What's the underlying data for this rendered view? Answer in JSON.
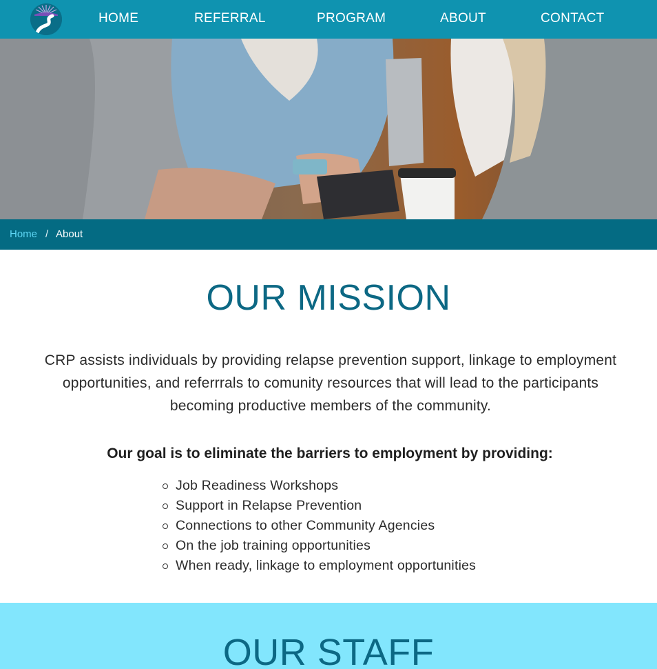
{
  "nav": {
    "items": [
      "HOME",
      "REFERRAL",
      "PROGRAM",
      "ABOUT",
      "CONTACT"
    ]
  },
  "breadcrumb": {
    "home": "Home",
    "separator": "/",
    "current": "About"
  },
  "mission": {
    "title": "OUR MISSION",
    "text": "CRP assists individuals by providing relapse prevention support, linkage to employment opportunities, and referrrals to comunity resources that will lead to the participants becoming productive members of the community.",
    "goal": "Our goal is to eliminate the barriers to employment by providing:",
    "list": [
      "Job Readiness Workshops",
      "Support in Relapse Prevention",
      "Connections to other Community Agencies",
      "On the job training opportunities",
      "When ready, linkage to employment opportunities"
    ]
  },
  "staff": {
    "title": "OUR STAFF"
  },
  "colors": {
    "nav_bg": "#0f93b0",
    "breadcrumb_bg": "#046b83",
    "title": "#0c6884",
    "staff_bg": "#82e6fd"
  }
}
